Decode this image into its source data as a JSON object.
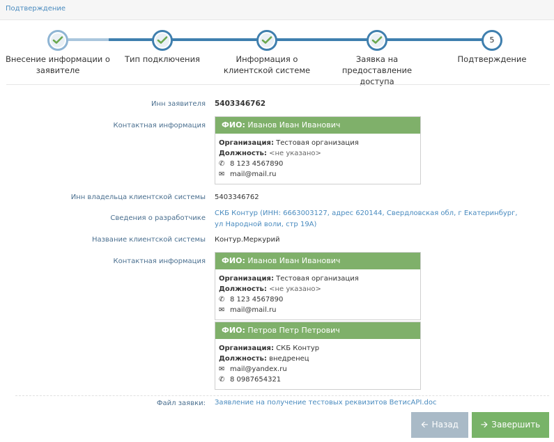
{
  "breadcrumb": "Подтверждение",
  "steps": [
    {
      "label": "Внесение информации о заявителе",
      "state": "done"
    },
    {
      "label": "Тип подключения",
      "state": "done"
    },
    {
      "label": "Информация о клиентской системе",
      "state": "done"
    },
    {
      "label": "Заявка на предоставление доступа",
      "state": "done"
    },
    {
      "label": "Подтверждение",
      "state": "current",
      "number": "5"
    }
  ],
  "applicant": {
    "inn_label": "Инн заявителя",
    "inn_value": "5403346762",
    "contact_label": "Контактная информация",
    "contact": {
      "fio_prefix": "ФИО:",
      "fio": "Иванов Иван Иванович",
      "org_label": "Организация:",
      "org": "Тестовая организация",
      "position_label": "Должность:",
      "position": "<не указано>",
      "phone": "8 123 4567890",
      "email": "mail@mail.ru"
    }
  },
  "client_system": {
    "owner_inn_label": "Инн владельца клиентской системы",
    "owner_inn_value": "5403346762",
    "developer_label": "Сведения о разработчике",
    "developer_value": "СКБ Контур (ИНН: 6663003127, адрес 620144, Свердловская обл, г Екатеринбург, ул Народной воли, стр 19А)",
    "name_label": "Название клиентской системы",
    "name_value": "Контур.Меркурий",
    "contact_label": "Контактная информация",
    "contacts": [
      {
        "fio_prefix": "ФИО:",
        "fio": "Иванов Иван Иванович",
        "org_label": "Организация:",
        "org": "Тестовая организация",
        "position_label": "Должность:",
        "position": "<не указано>",
        "phone": "8 123 4567890",
        "email": "mail@mail.ru"
      },
      {
        "fio_prefix": "ФИО:",
        "fio": "Петров Петр Петрович",
        "org_label": "Организация:",
        "org": "СКБ Контур",
        "position_label": "Должность:",
        "position": "внедренец",
        "email": "mail@yandex.ru",
        "phone": "8 0987654321"
      }
    ]
  },
  "file": {
    "label": "Файл заявки:",
    "value": "Заявление на получение тестовых реквизитов ВетисAPI.doc"
  },
  "buttons": {
    "back": "Назад",
    "finish": "Завершить"
  },
  "colors": {
    "accent_blue": "#3f7fae",
    "card_header_green": "#7fb06a",
    "finish_green": "#78b368",
    "back_gray": "#a9bac7",
    "link_blue": "#4a8bbf"
  }
}
